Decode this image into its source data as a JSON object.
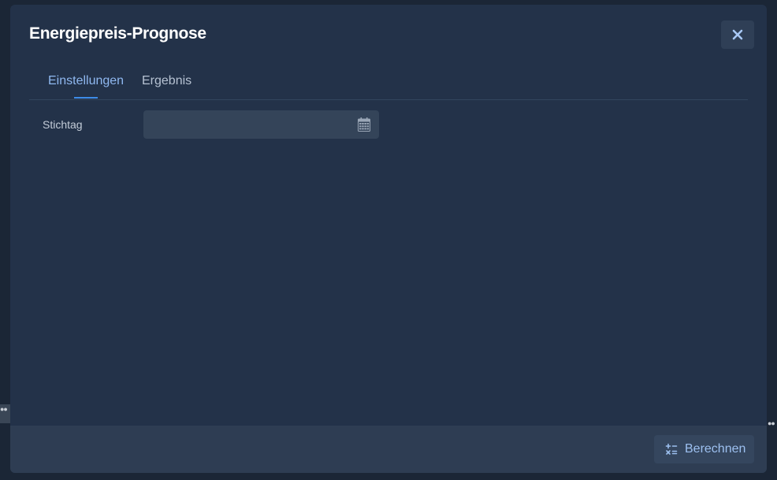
{
  "dialog": {
    "title": "Energiepreis-Prognose",
    "close_icon": "close-icon"
  },
  "tabs": [
    {
      "label": "Einstellungen",
      "active": true
    },
    {
      "label": "Ergebnis",
      "active": false
    }
  ],
  "form": {
    "stichtag_label": "Stichtag",
    "stichtag_value": "",
    "calendar_icon": "calendar-icon"
  },
  "footer": {
    "calculate_label": "Berechnen",
    "calculate_icon": "calculator-icon"
  },
  "colors": {
    "dialog_bg": "#233249",
    "footer_bg": "#2e3d53",
    "accent": "#3d8be8",
    "active_tab_text": "#8fb8f0"
  }
}
